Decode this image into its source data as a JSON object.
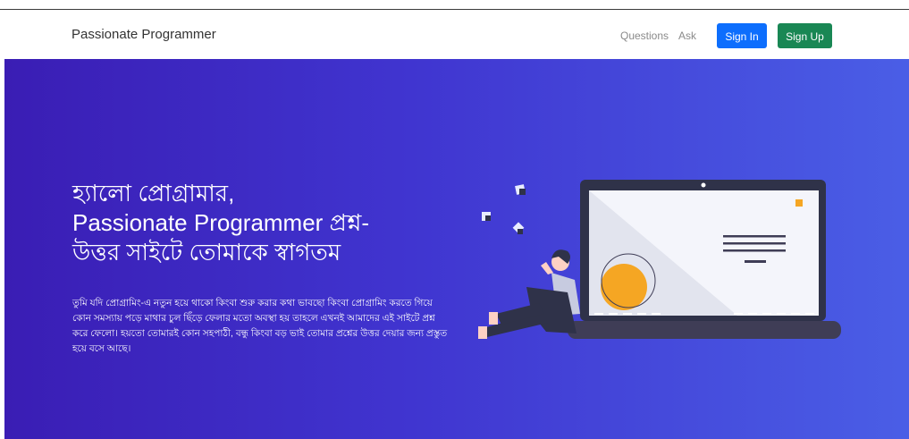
{
  "navbar": {
    "brand": "Passionate Programmer",
    "links": [
      "Questions",
      "Ask"
    ],
    "sign_in": "Sign In",
    "sign_up": "Sign Up"
  },
  "hero": {
    "title_lines": [
      "হ্যালো প্রোগ্রামার,",
      "Passionate Programmer প্রশ্ন-",
      "উত্তর সাইটে তোমাকে স্বাগতম"
    ],
    "body": "তুমি যদি প্রোগ্রামিং-এ নতুন হয়ে থাকো কিংবা শুরু করার কথা ভাবছো কিংবা প্রোগ্রামিং করতে গিয়ে কোন সমস্যায় পড়ে মাথার চুল ছিঁড়ে ফেলার মতো অবস্থা হয় তাহলে এখনই আমাদের এই সাইটে প্রশ্ন করে ফেলো। হয়তো তোমারই কোন সহপাঠী, বন্ধু কিংবা বড় ভাই তোমার প্রশ্নের উত্তর দেয়ার জন্য প্রস্তুত হয়ে বসে আছে।"
  },
  "colors": {
    "primary": "#0d6efd",
    "success": "#198754",
    "hero_start": "#3a1db4",
    "hero_end": "#4a5ee6",
    "accent_orange": "#f5a623"
  }
}
